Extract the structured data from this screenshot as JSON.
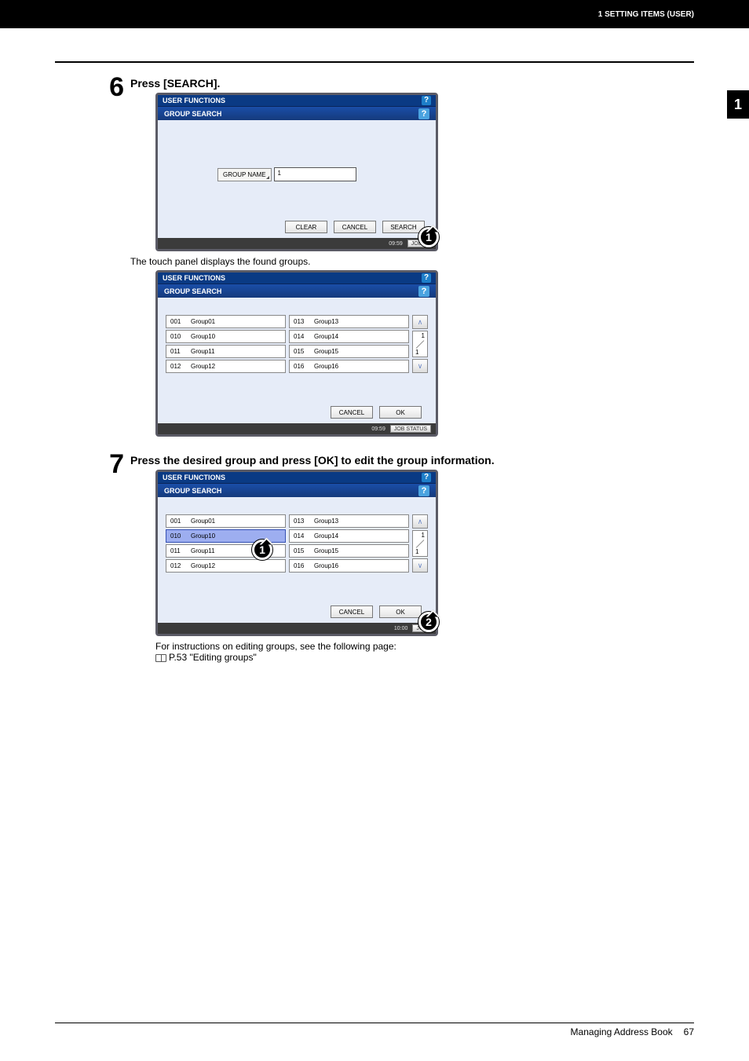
{
  "header": {
    "section": "1 SETTING ITEMS (USER)"
  },
  "sideTab": "1",
  "step6": {
    "num": "6",
    "title": "Press [SEARCH].",
    "titlebar": "USER FUNCTIONS",
    "subbar": "GROUP SEARCH",
    "groupNameLabel": "GROUP NAME",
    "groupNameValue": "1",
    "buttons": {
      "clear": "CLEAR",
      "cancel": "CANCEL",
      "search": "SEARCH"
    },
    "time": "09:59",
    "jobs": "JOB S"
  },
  "note6b": "The touch panel displays the found groups.",
  "panel6b": {
    "titlebar": "USER FUNCTIONS",
    "subbar": "GROUP SEARCH",
    "col1": [
      {
        "id": "001",
        "name": "Group01"
      },
      {
        "id": "010",
        "name": "Group10"
      },
      {
        "id": "011",
        "name": "Group11"
      },
      {
        "id": "012",
        "name": "Group12"
      }
    ],
    "col2": [
      {
        "id": "013",
        "name": "Group13"
      },
      {
        "id": "014",
        "name": "Group14"
      },
      {
        "id": "015",
        "name": "Group15"
      },
      {
        "id": "016",
        "name": "Group16"
      }
    ],
    "page": {
      "cur": "1",
      "tot": "1"
    },
    "buttons": {
      "cancel": "CANCEL",
      "ok": "OK"
    },
    "time": "09:59",
    "jobs": "JOB STATUS"
  },
  "step7": {
    "num": "7",
    "title": "Press the desired group and press [OK] to edit the group information.",
    "titlebar": "USER FUNCTIONS",
    "subbar": "GROUP SEARCH",
    "col1": [
      {
        "id": "001",
        "name": "Group01"
      },
      {
        "id": "010",
        "name": "Group10",
        "selected": true
      },
      {
        "id": "011",
        "name": "Group11"
      },
      {
        "id": "012",
        "name": "Group12"
      }
    ],
    "col2": [
      {
        "id": "013",
        "name": "Group13"
      },
      {
        "id": "014",
        "name": "Group14"
      },
      {
        "id": "015",
        "name": "Group15"
      },
      {
        "id": "016",
        "name": "Group16"
      }
    ],
    "page": {
      "cur": "1",
      "tot": "1"
    },
    "buttons": {
      "cancel": "CANCEL",
      "ok": "OK"
    },
    "time": "10:00",
    "jobs": "JOB"
  },
  "ref": {
    "line1": "For instructions on editing groups, see the following page:",
    "line2": "P.53 \"Editing groups\""
  },
  "footer": {
    "title": "Managing Address Book",
    "page": "67"
  },
  "help": "?"
}
